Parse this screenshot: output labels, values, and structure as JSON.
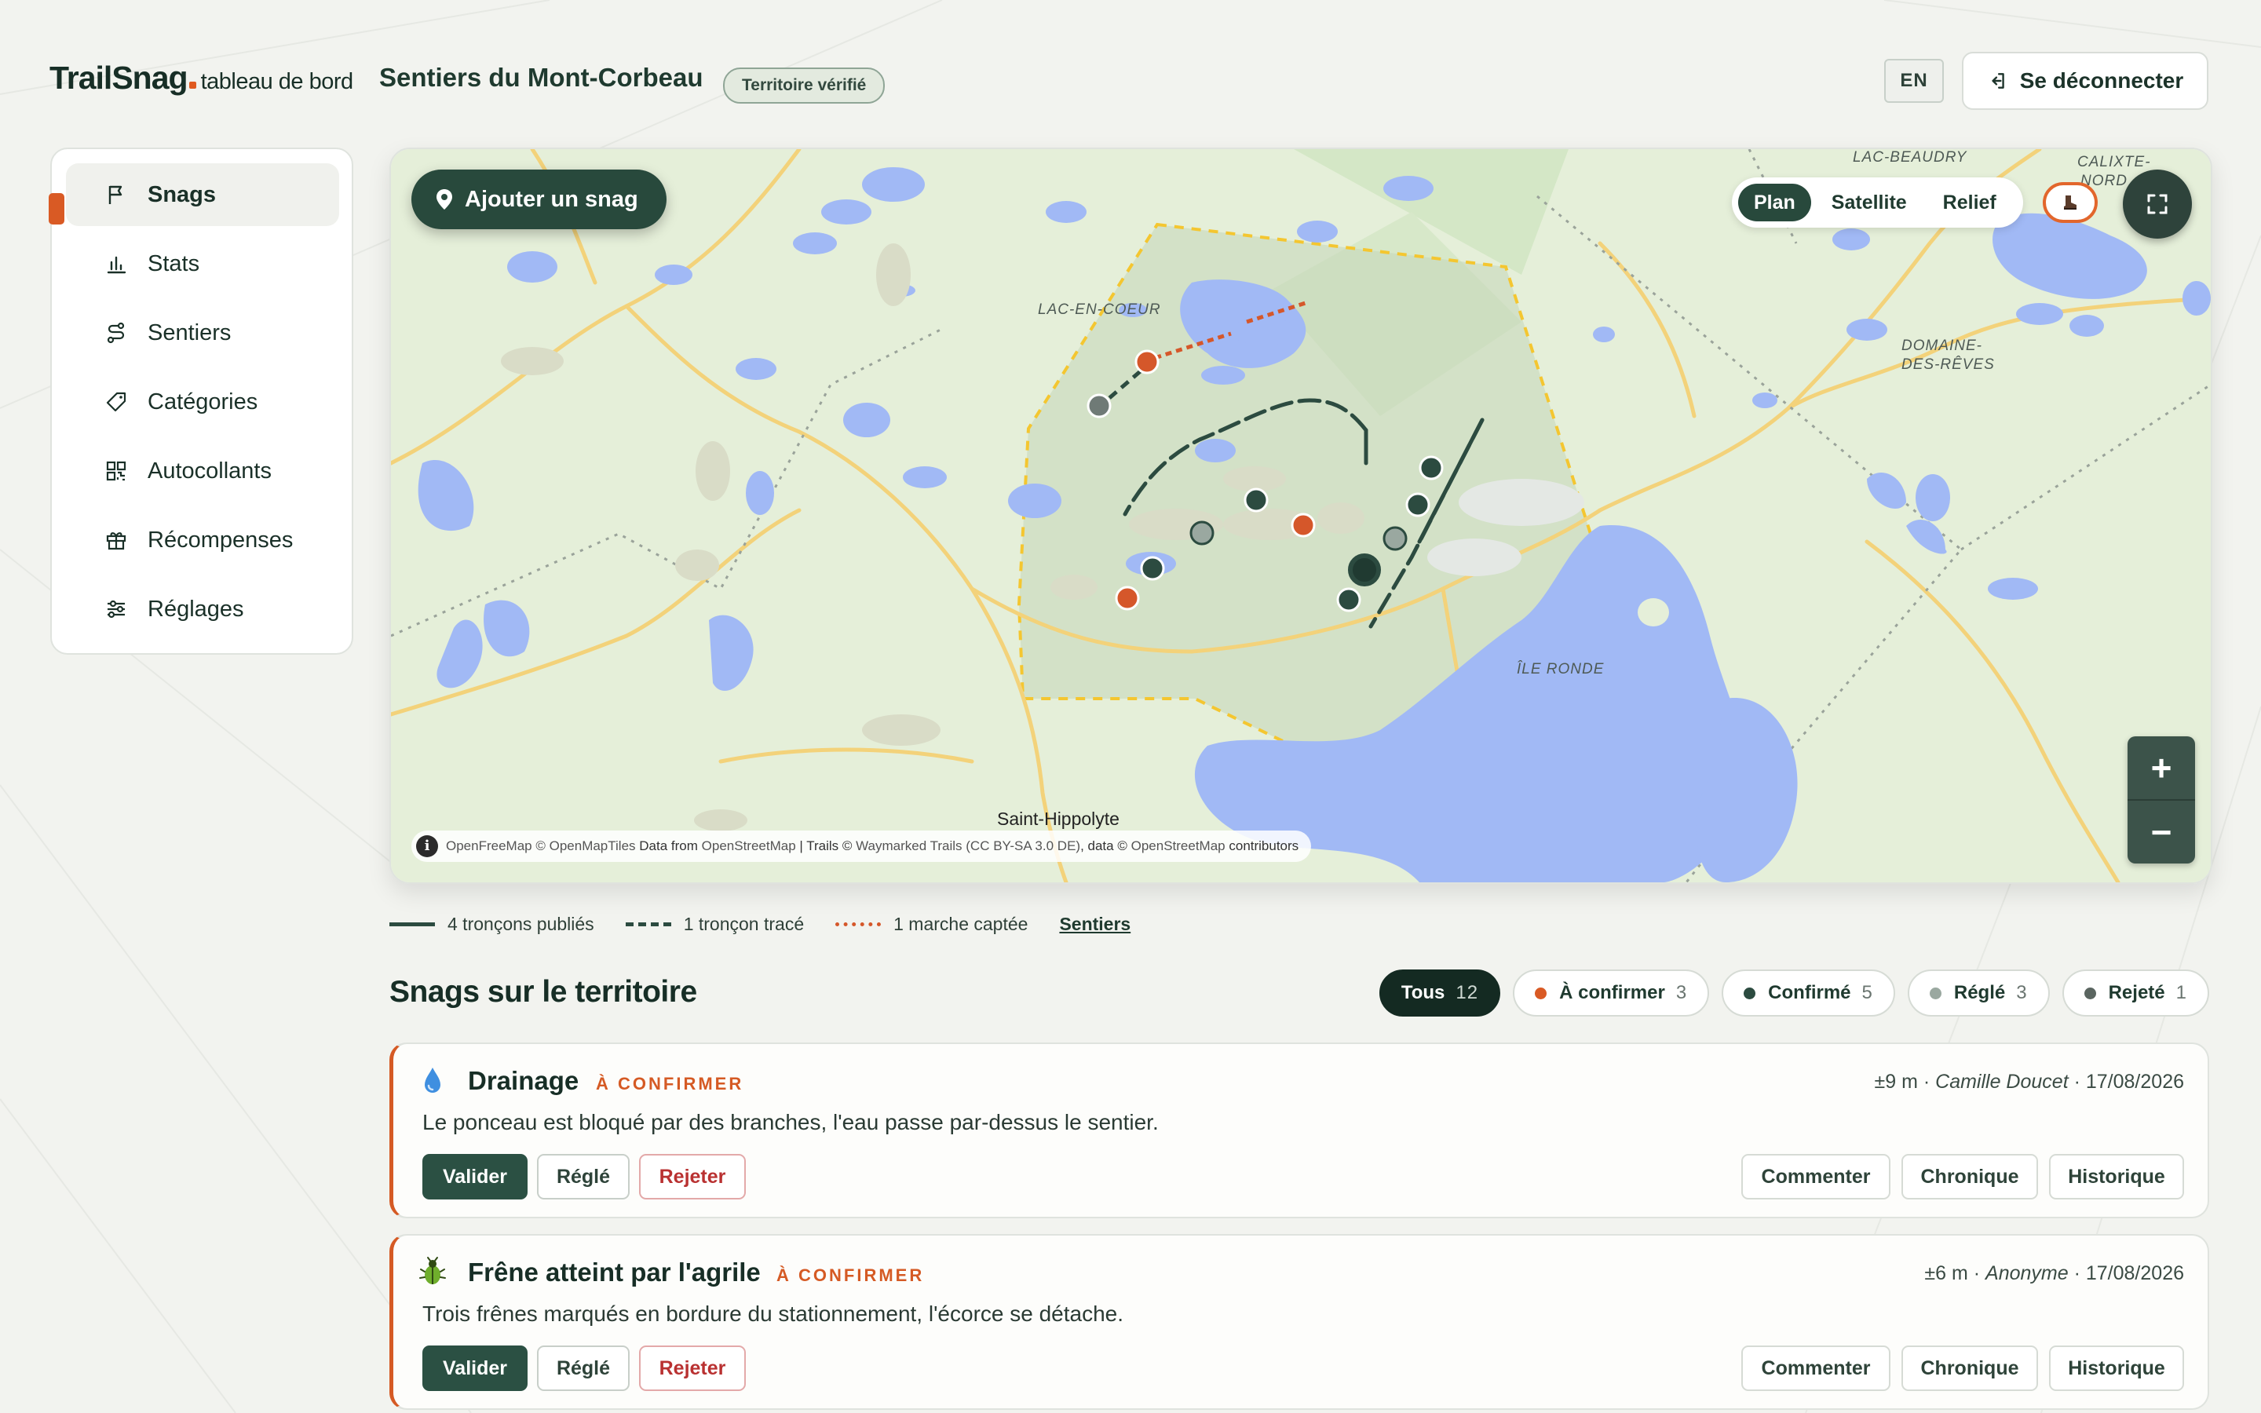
{
  "header": {
    "brand": "TrailSnag",
    "brand_sub": "tableau de bord",
    "site_name": "Sentiers du Mont-Corbeau",
    "verified_badge": "Territoire vérifié",
    "lang_button": "EN",
    "logout_label": "Se déconnecter"
  },
  "sidebar": {
    "items": [
      {
        "label": "Snags",
        "icon": "flag-icon",
        "active": true
      },
      {
        "label": "Stats",
        "icon": "bar-chart-icon"
      },
      {
        "label": "Sentiers",
        "icon": "route-icon"
      },
      {
        "label": "Catégories",
        "icon": "tag-icon"
      },
      {
        "label": "Autocollants",
        "icon": "qr-code-icon"
      },
      {
        "label": "Récompenses",
        "icon": "gift-icon"
      },
      {
        "label": "Réglages",
        "icon": "sliders-icon"
      }
    ]
  },
  "map": {
    "add_snag_label": "Ajouter un snag",
    "view_options": [
      "Plan",
      "Satellite",
      "Relief"
    ],
    "active_view": "Plan",
    "zoom_in": "+",
    "zoom_out": "−",
    "labels": {
      "lac_beaudry": "LAC-BEAUDRY",
      "calixte_1": "CALIXTE-",
      "calixte_2": "NORD",
      "lac_en_coeur": "LAC-EN-COEUR",
      "domaine_1": "DOMAINE-",
      "domaine_2": "DES-RÊVES",
      "ile_ronde": "ÎLE RONDE",
      "saint_hippolyte": "Saint-Hippolyte"
    },
    "attribution": {
      "info": "i",
      "p1": "OpenFreeMap",
      "p2": "© OpenMapTiles",
      "p3": "Data from",
      "p4": "OpenStreetMap",
      "p5": "| Trails ©",
      "p6": "Waymarked Trails (CC BY-SA 3.0 DE)",
      "p7": ", data ©",
      "p8": "OpenStreetMap",
      "p9": "contributors"
    },
    "colors": {
      "water": "#a1b9f5",
      "land": "#e5efd9",
      "territory": "#f4c630",
      "published": "#2c4b40",
      "captured": "#d5572a"
    }
  },
  "legend": {
    "published": "4 tronçons publiés",
    "traced": "1 tronçon tracé",
    "captured": "1 marche captée",
    "link": "Sentiers"
  },
  "section": {
    "title": "Snags sur le territoire",
    "filters": [
      {
        "label": "Tous",
        "count": "12",
        "active": true
      },
      {
        "label": "À confirmer",
        "count": "3",
        "dot": "#d95a24"
      },
      {
        "label": "Confirmé",
        "count": "5",
        "dot": "#2c4b40"
      },
      {
        "label": "Réglé",
        "count": "3",
        "dot": "#9aa8a0"
      },
      {
        "label": "Rejeté",
        "count": "1",
        "dot": "#5a6560"
      }
    ]
  },
  "snags": [
    {
      "icon": "water-drop-icon",
      "title": "Drainage",
      "status": "À CONFIRMER",
      "precision": "±9 m",
      "author": "Camille Doucet",
      "date": "17/08/2026",
      "description": "Le ponceau est bloqué par des branches, l'eau passe par-dessus le sentier.",
      "actions": {
        "validate": "Valider",
        "settled": "Réglé",
        "reject": "Rejeter",
        "comment": "Commenter",
        "timeline": "Chronique",
        "history": "Historique"
      }
    },
    {
      "icon": "beetle-icon",
      "title": "Frêne atteint par l'agrile",
      "status": "À CONFIRMER",
      "precision": "±6 m",
      "author": "Anonyme",
      "date": "17/08/2026",
      "description": "Trois frênes marqués en bordure du stationnement, l'écorce se détache.",
      "actions": {
        "validate": "Valider",
        "settled": "Réglé",
        "reject": "Rejeter",
        "comment": "Commenter",
        "timeline": "Chronique",
        "history": "Historique"
      }
    }
  ]
}
